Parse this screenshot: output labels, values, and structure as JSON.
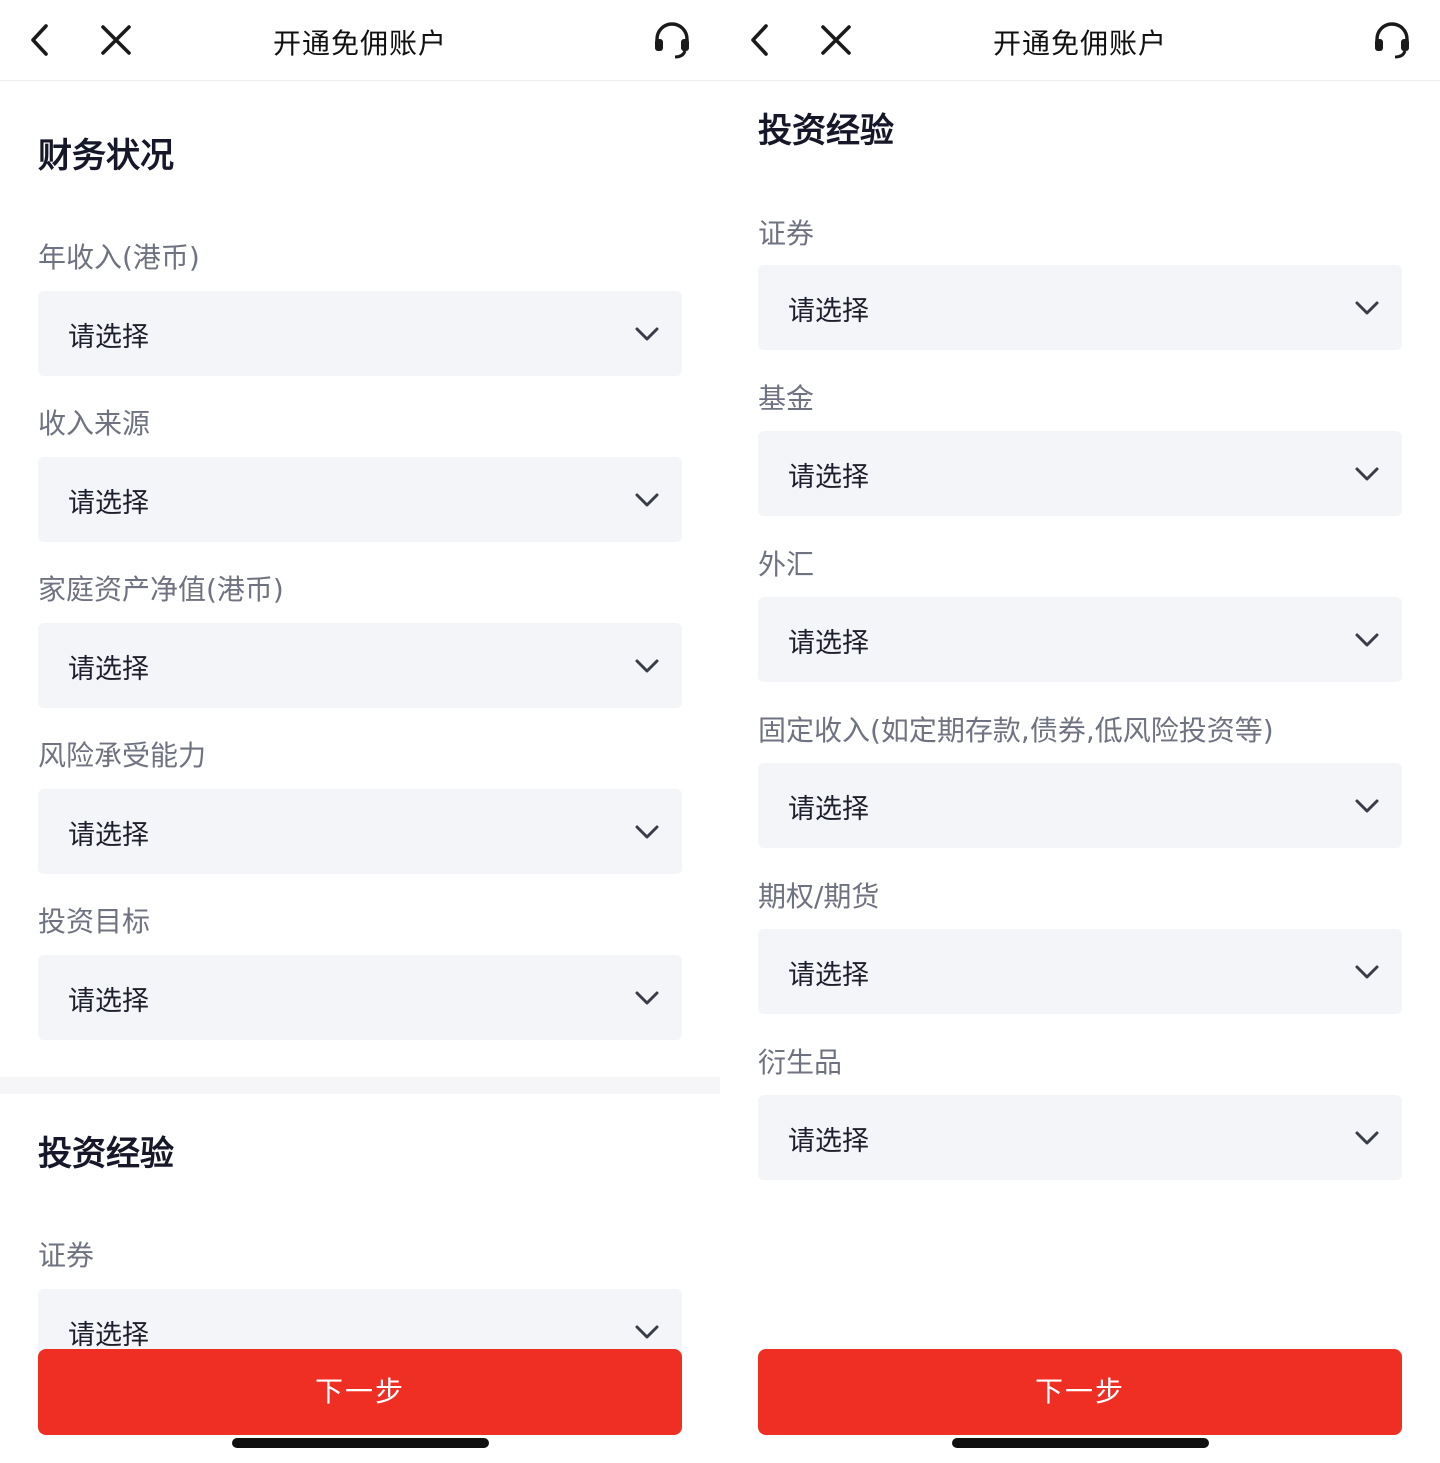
{
  "colors": {
    "accent": "#ef2e24",
    "field_bg": "#f4f5f9",
    "label": "#6f7280"
  },
  "left": {
    "header": {
      "title": "开通免佣账户",
      "back_icon": "chevron-left-icon",
      "close_icon": "close-icon",
      "service_icon": "headset-icon"
    },
    "sections": [
      {
        "title": "财务状况",
        "fields": [
          {
            "label": "年收入(港币)",
            "value": "请选择"
          },
          {
            "label": "收入来源",
            "value": "请选择"
          },
          {
            "label": "家庭资产净值(港币)",
            "value": "请选择"
          },
          {
            "label": "风险承受能力",
            "value": "请选择"
          },
          {
            "label": "投资目标",
            "value": "请选择"
          }
        ]
      },
      {
        "title": "投资经验",
        "fields": [
          {
            "label": "证券",
            "value": "请选择"
          }
        ]
      }
    ],
    "next_label": "下一步"
  },
  "right": {
    "header": {
      "title": "开通免佣账户",
      "back_icon": "chevron-left-icon",
      "close_icon": "close-icon",
      "service_icon": "headset-icon"
    },
    "sections": [
      {
        "title": "投资经验",
        "fields": [
          {
            "label": "证券",
            "value": "请选择"
          },
          {
            "label": "基金",
            "value": "请选择"
          },
          {
            "label": "外汇",
            "value": "请选择"
          },
          {
            "label": "固定收入(如定期存款,债券,低风险投资等)",
            "value": "请选择"
          },
          {
            "label": "期权/期货",
            "value": "请选择"
          },
          {
            "label": "衍生品",
            "value": "请选择"
          }
        ]
      }
    ],
    "next_label": "下一步"
  }
}
